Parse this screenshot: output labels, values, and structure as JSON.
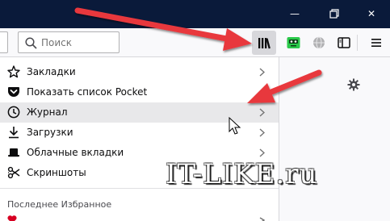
{
  "window": {
    "minimize_icon": "minimize-icon",
    "restore_icon": "restore-icon",
    "close_icon": "close-icon",
    "minimize_glyph": "—",
    "close_glyph": "✕"
  },
  "toolbar": {
    "search": {
      "placeholder": "Поиск",
      "value": ""
    },
    "buttons": [
      "library-icon",
      "extension-icon",
      "globe-icon",
      "sidebar-icon",
      "hamburger-menu-icon"
    ]
  },
  "library_menu": {
    "items": [
      {
        "label": "Закладки",
        "icon": "star-icon",
        "has_submenu": true
      },
      {
        "label": "Показать список Pocket",
        "icon": "pocket-icon",
        "has_submenu": false
      },
      {
        "label": "Журнал",
        "icon": "clock-icon",
        "has_submenu": true,
        "hovered": true
      },
      {
        "label": "Загрузки",
        "icon": "download-icon",
        "has_submenu": true
      },
      {
        "label": "Облачные вкладки",
        "icon": "synced-tabs-icon",
        "has_submenu": true
      },
      {
        "label": "Скриншоты",
        "icon": "scissors-icon",
        "has_submenu": false
      }
    ],
    "section_title": "Последнее Избранное"
  },
  "watermark": "IT-LIKE.ru",
  "colors": {
    "titlebar": "#0a1a3a",
    "toolbar": "#f9f9fb",
    "menu_hover": "#e8e8ea",
    "annotation_arrow": "#e8383d",
    "extension_green": "#2ac94a"
  }
}
